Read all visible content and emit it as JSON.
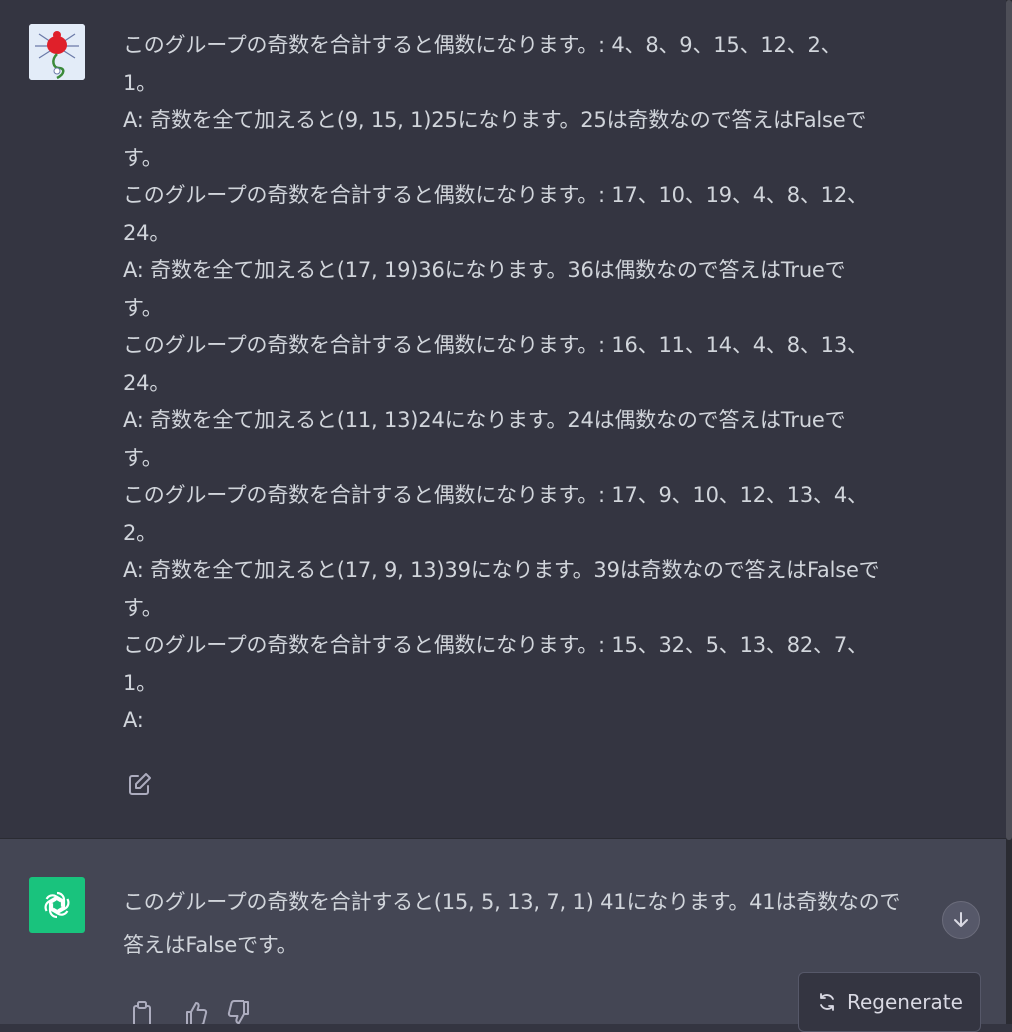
{
  "user_message": {
    "lines": [
      "このグループの奇数を合計すると偶数になります。: 4、8、9、15、12、2、",
      "1。",
      "A: 奇数を全て加えると(9, 15, 1)25になります。25は奇数なので答えはFalseで",
      "す。",
      "このグループの奇数を合計すると偶数になります。: 17、10、19、4、8、12、",
      "24。",
      "A: 奇数を全て加えると(17, 19)36になります。36は偶数なので答えはTrueで",
      "す。",
      "このグループの奇数を合計すると偶数になります。: 16、11、14、4、8、13、",
      "24。",
      "A: 奇数を全て加えると(11, 13)24になります。24は偶数なので答えはTrueで",
      "す。",
      "このグループの奇数を合計すると偶数になります。: 17、9、10、12、13、4、",
      "2。",
      "A: 奇数を全て加えると(17, 9, 13)39になります。39は奇数なので答えはFalseで",
      "す。",
      "このグループの奇数を合計すると偶数になります。: 15、32、5、13、82、7、",
      "1。",
      "A:"
    ]
  },
  "assistant_message": {
    "lines": [
      "このグループの奇数を合計すると(15, 5, 13, 7, 1) 41になります。41は奇数なので",
      "答えはFalseです。"
    ]
  },
  "controls": {
    "regenerate_label": "Regenerate"
  },
  "icons": {
    "user_avatar": "red-bug-avatar",
    "assistant_avatar": "openai-logo-icon",
    "edit": "edit-icon",
    "scroll_down": "arrow-down-icon",
    "copy": "clipboard-icon",
    "thumbs_up": "thumbs-up-icon",
    "thumbs_down": "thumbs-down-icon",
    "regenerate": "refresh-icon"
  },
  "colors": {
    "background": "#343541",
    "assistant_background": "#444654",
    "accent": "#19c37d",
    "text": "#d1d5db"
  }
}
